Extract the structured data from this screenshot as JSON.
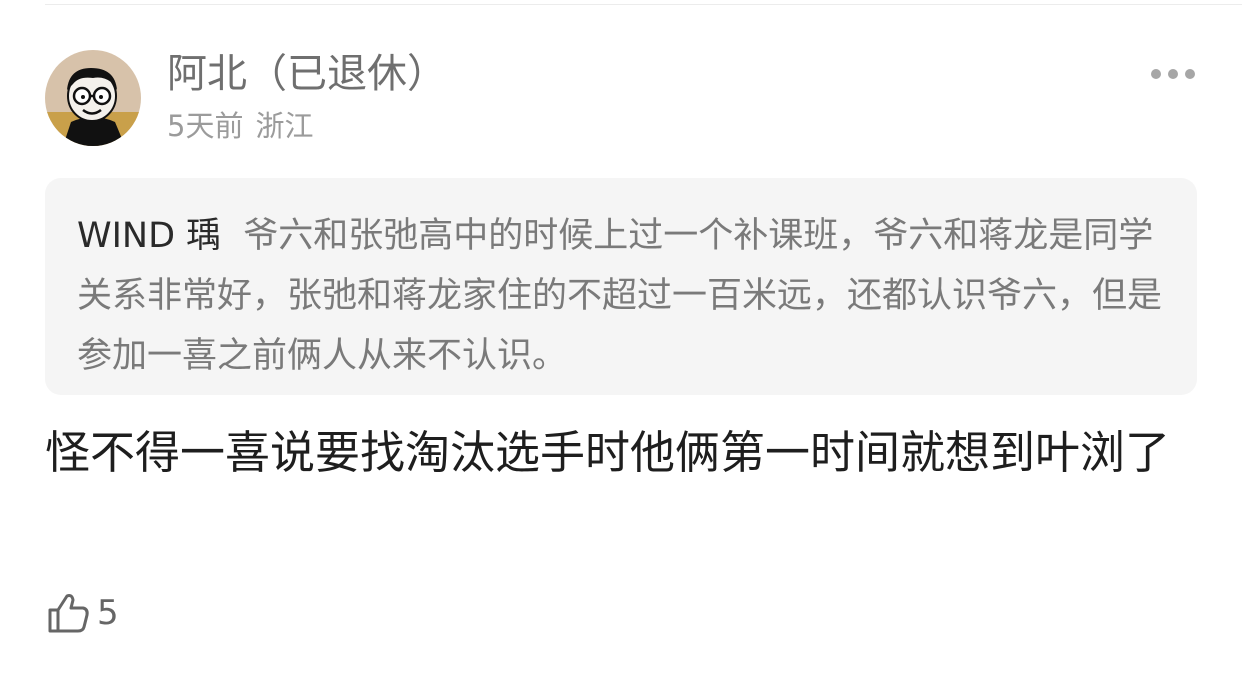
{
  "comment": {
    "author": {
      "name": "阿北（已退休）",
      "avatar_icon": "cartoon-avatar-icon"
    },
    "meta": {
      "time": "5天前",
      "location": "浙江"
    },
    "more_icon": "more-dots-icon",
    "quoted_reply": {
      "author": "WIND 瑀",
      "text": "爷六和张弛高中的时候上过一个补课班，爷六和蒋龙是同学关系非常好，张弛和蒋龙家住的不超过一百米远，还都认识爷六，但是参加一喜之前俩人从来不认识。"
    },
    "body": "怪不得一喜说要找淘汰选手时他俩第一时间就想到叶浏了",
    "likes": {
      "icon": "thumbs-up-icon",
      "count": "5"
    }
  },
  "colors": {
    "name": "#6f6f6f",
    "meta": "#9b9b9b",
    "quote_bg": "#f5f5f5",
    "quote_text": "#7a7a7a",
    "body_text": "#1e1e1e"
  }
}
